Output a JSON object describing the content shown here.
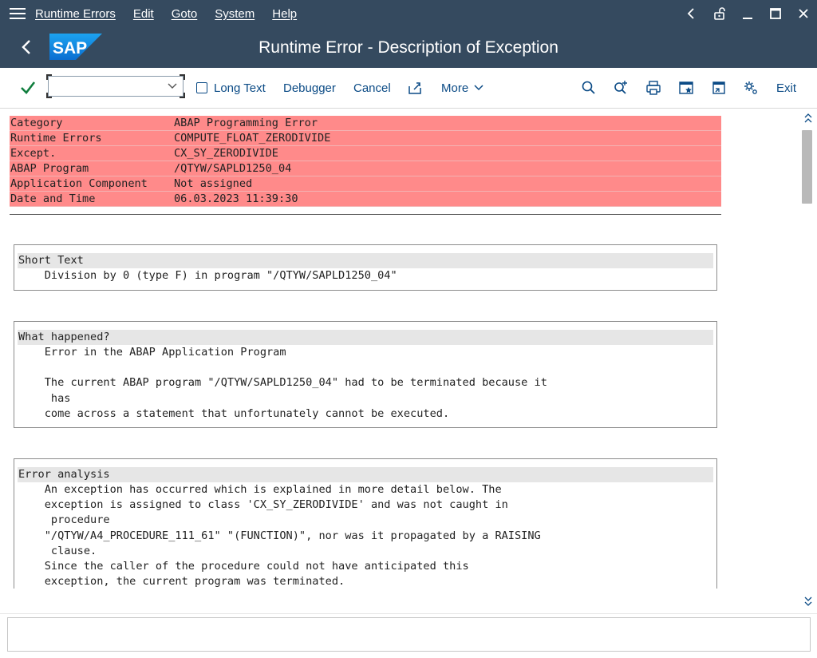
{
  "menubar": {
    "items": [
      "Runtime Errors",
      "Edit",
      "Goto",
      "System",
      "Help"
    ]
  },
  "titlebar": {
    "title": "Runtime Error - Description of Exception",
    "logo_text": "SAP"
  },
  "toolbar": {
    "command_field": {
      "value": "",
      "placeholder": ""
    },
    "long_text": "Long Text",
    "debugger": "Debugger",
    "cancel": "Cancel",
    "more": "More",
    "exit": "Exit"
  },
  "header": {
    "rows": [
      {
        "key": "Category",
        "value": "ABAP Programming Error"
      },
      {
        "key": "Runtime Errors",
        "value": "COMPUTE_FLOAT_ZERODIVIDE"
      },
      {
        "key": "Except.",
        "value": "CX_SY_ZERODIVIDE"
      },
      {
        "key": "ABAP Program",
        "value": "/QTYW/SAPLD1250_04"
      },
      {
        "key": "Application Component",
        "value": "Not assigned"
      },
      {
        "key": "Date and Time",
        "value": "06.03.2023 11:39:30"
      }
    ]
  },
  "sections": [
    {
      "title": "Short Text",
      "lines": [
        "    Division by 0 (type F) in program \"/QTYW/SAPLD1250_04\""
      ]
    },
    {
      "title": "What happened?",
      "lines": [
        "    Error in the ABAP Application Program",
        "",
        "    The current ABAP program \"/QTYW/SAPLD1250_04\" had to be terminated because it",
        "     has",
        "    come across a statement that unfortunately cannot be executed."
      ]
    },
    {
      "title": "Error analysis",
      "lines": [
        "    An exception has occurred which is explained in more detail below. The",
        "    exception is assigned to class 'CX_SY_ZERODIVIDE' and was not caught in",
        "     procedure",
        "    \"/QTYW/A4_PROCEDURE_111_61\" \"(FUNCTION)\", nor was it propagated by a RAISING",
        "     clause.",
        "    Since the caller of the procedure could not have anticipated this",
        "    exception, the current program was terminated."
      ]
    }
  ],
  "colors": {
    "shell": "#354a5f",
    "header_highlight": "#ff8a8a",
    "toolbar_text": "#0a4a85",
    "confirm_green": "#107e3e"
  },
  "icons": {
    "menu": "hamburger-icon",
    "back": "chevron-left-icon",
    "confirm": "checkmark-icon",
    "upload": "upload-icon",
    "find": "search-icon",
    "find_next": "search-next-icon",
    "print": "printer-icon",
    "new_session": "new-session-icon",
    "shortcut": "shortcut-icon",
    "settings": "settings-icon"
  }
}
